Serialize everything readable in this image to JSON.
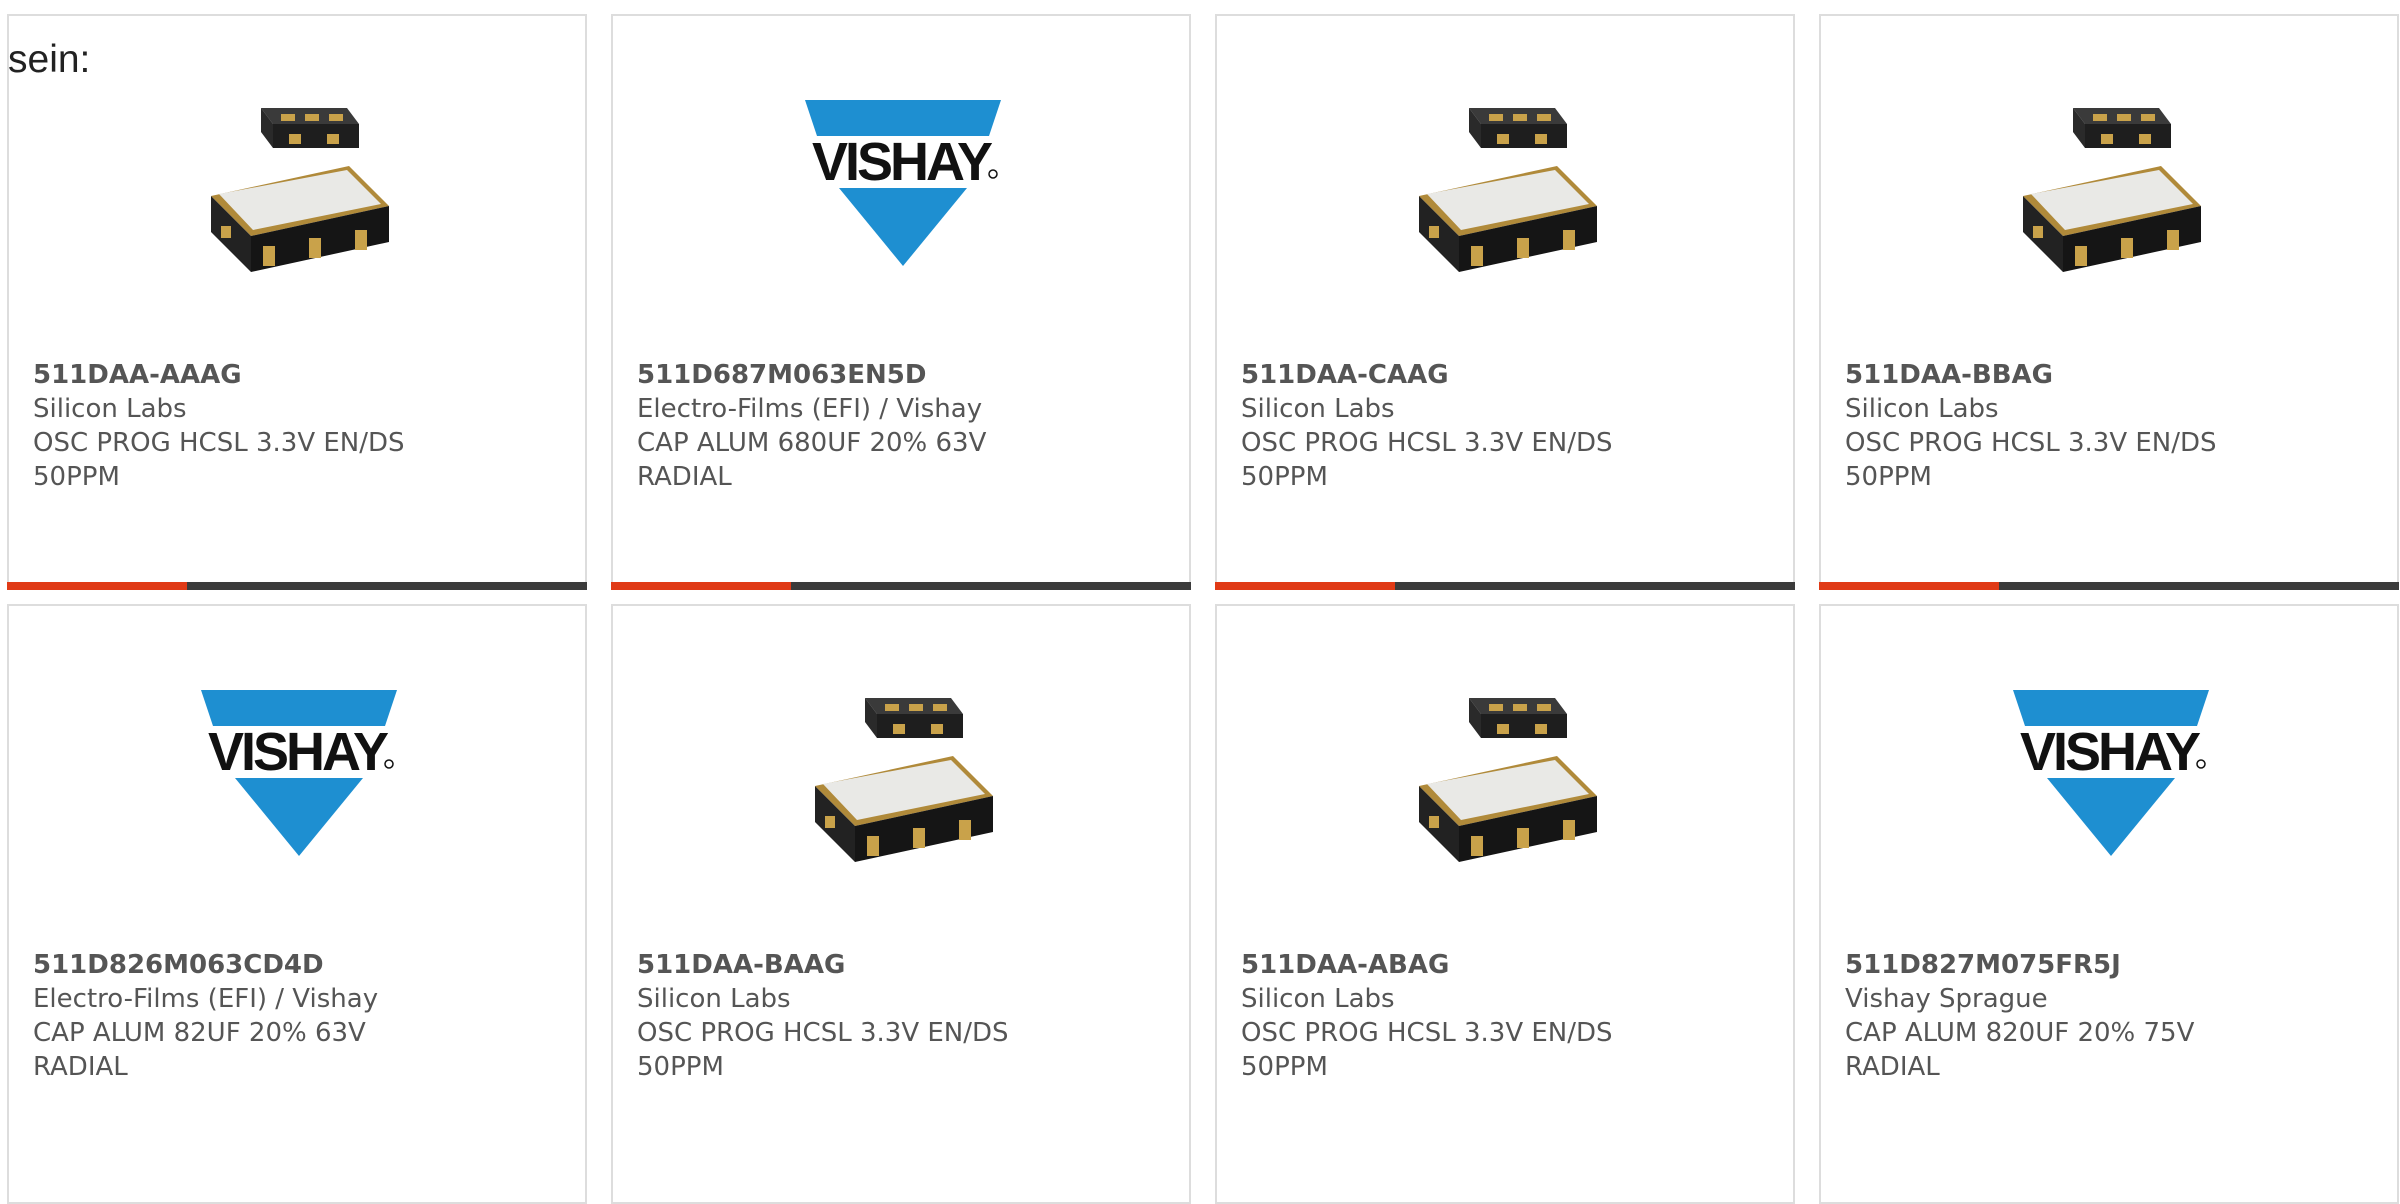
{
  "intro_text": "sein:",
  "colors": {
    "accent": "#e03a16",
    "bar_track": "#3b3b3b",
    "border": "#dddddd",
    "text": "#555555"
  },
  "cards": [
    {
      "image": "oscillator-package",
      "part": "511DAA-AAAG",
      "manufacturer": "Silicon Labs",
      "desc1": "OSC PROG HCSL 3.3V EN/DS",
      "desc2": "50PPM",
      "progress": 0.31
    },
    {
      "image": "vishay-logo",
      "part": "511D687M063EN5D",
      "manufacturer": "Electro-Films (EFI) / Vishay",
      "desc1": "CAP ALUM 680UF 20% 63V",
      "desc2": "RADIAL",
      "progress": 0.31
    },
    {
      "image": "oscillator-package",
      "part": "511DAA-CAAG",
      "manufacturer": "Silicon Labs",
      "desc1": "OSC PROG HCSL 3.3V EN/DS",
      "desc2": "50PPM",
      "progress": 0.31
    },
    {
      "image": "oscillator-package",
      "part": "511DAA-BBAG",
      "manufacturer": "Silicon Labs",
      "desc1": "OSC PROG HCSL 3.3V EN/DS",
      "desc2": "50PPM",
      "progress": 0.31
    },
    {
      "image": "vishay-logo",
      "part": "511D826M063CD4D",
      "manufacturer": "Electro-Films (EFI) / Vishay",
      "desc1": "CAP ALUM 82UF 20% 63V",
      "desc2": "RADIAL"
    },
    {
      "image": "oscillator-package",
      "part": "511DAA-BAAG",
      "manufacturer": "Silicon Labs",
      "desc1": "OSC PROG HCSL 3.3V EN/DS",
      "desc2": "50PPM"
    },
    {
      "image": "oscillator-package",
      "part": "511DAA-ABAG",
      "manufacturer": "Silicon Labs",
      "desc1": "OSC PROG HCSL 3.3V EN/DS",
      "desc2": "50PPM"
    },
    {
      "image": "vishay-logo",
      "part": "511D827M075FR5J",
      "manufacturer": "Vishay Sprague",
      "desc1": "CAP ALUM 820UF 20% 75V",
      "desc2": "RADIAL"
    }
  ]
}
